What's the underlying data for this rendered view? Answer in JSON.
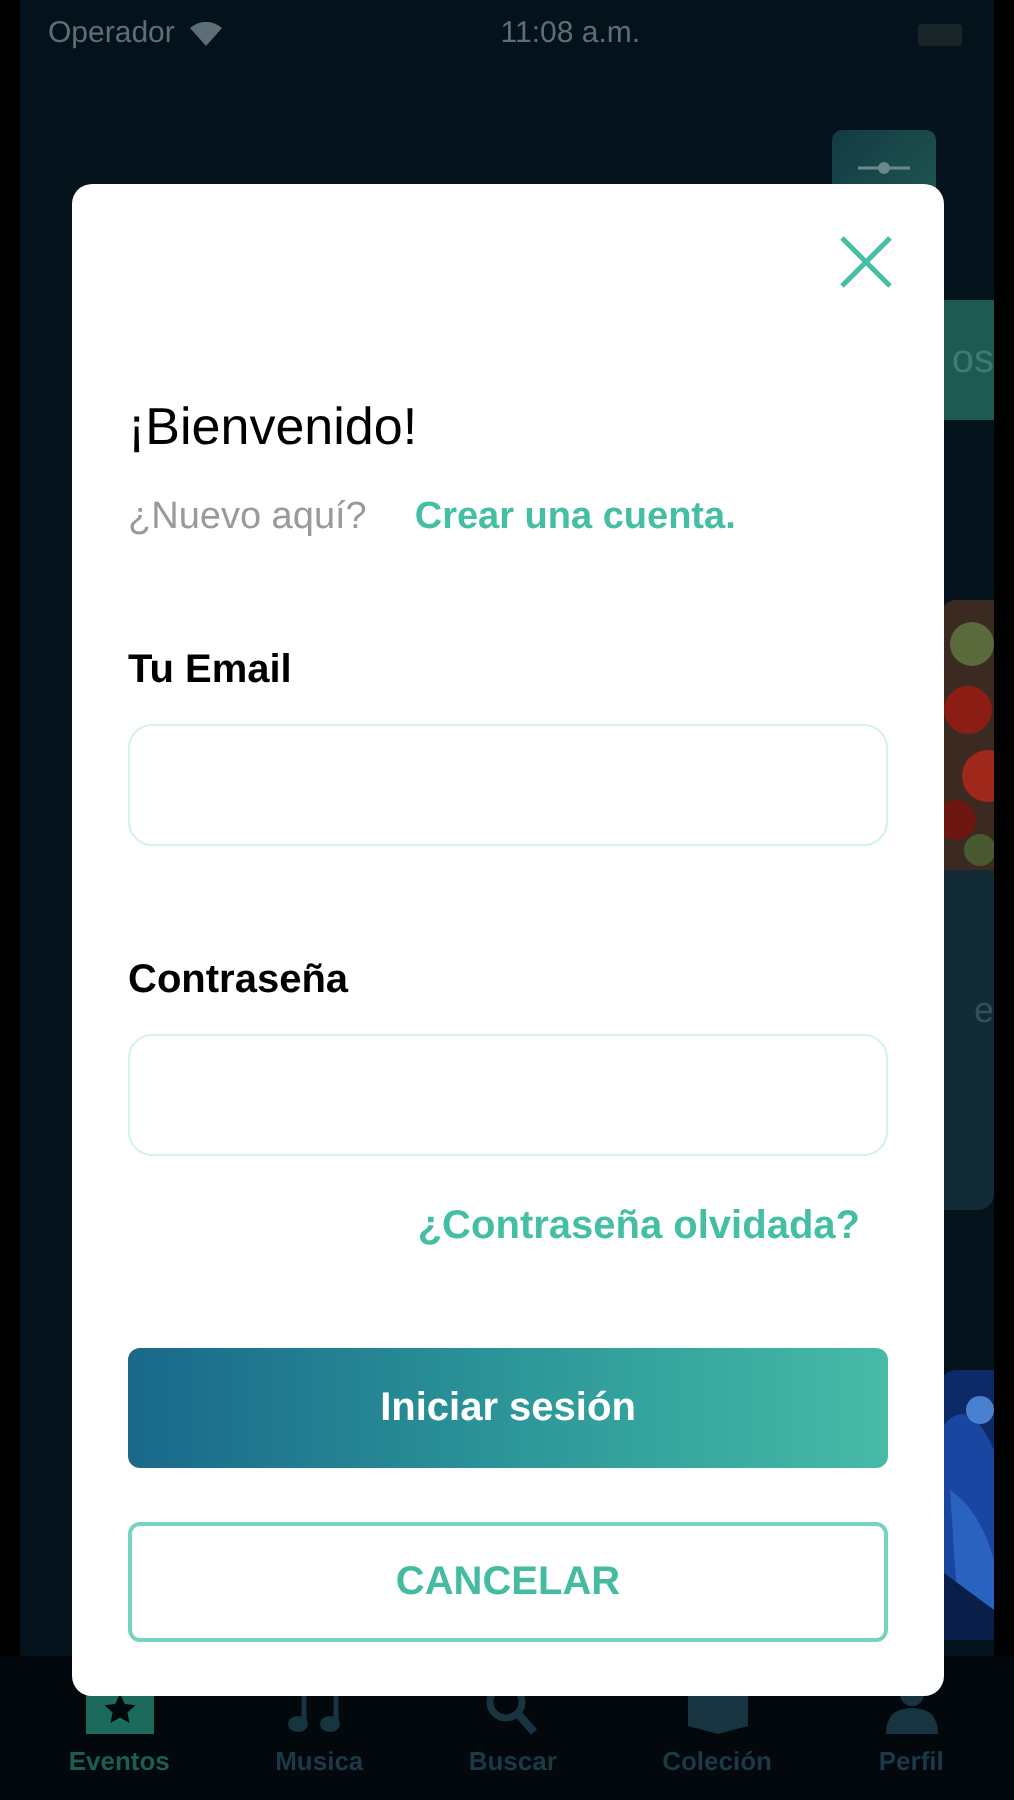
{
  "status_bar": {
    "carrier": "Operador",
    "time": "11:08 a.m."
  },
  "side_tab": {
    "label": "os"
  },
  "side_card": {
    "text": "e"
  },
  "modal": {
    "title": "¡Bienvenido!",
    "prompt": "¿Nuevo aquí?",
    "signup_link": "Crear una cuenta.",
    "fields": [
      {
        "label": "Tu Email"
      },
      {
        "label": "Contraseña"
      }
    ],
    "forgot_link": "¿Contraseña olvidada?",
    "buttons": [
      {
        "kind": "primary",
        "label": "Iniciar sesión"
      },
      {
        "kind": "outline",
        "label": "CANCELAR"
      }
    ]
  },
  "tab_bar": [
    {
      "label": "Eventos",
      "selected": true
    },
    {
      "label": "Musica",
      "selected": false
    },
    {
      "label": "Buscar",
      "selected": false
    },
    {
      "label": "Coleción",
      "selected": false
    },
    {
      "label": "Perfil",
      "selected": false
    }
  ]
}
